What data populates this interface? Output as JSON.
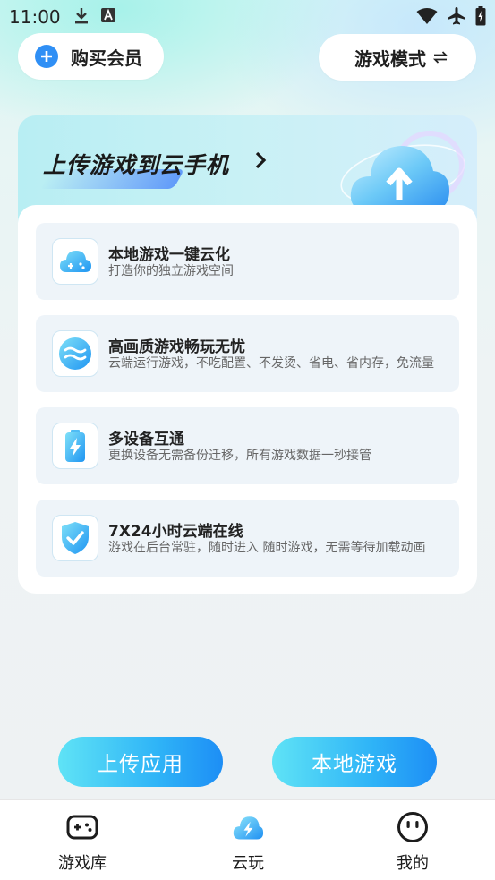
{
  "status_bar": {
    "time": "11:00",
    "icons": [
      "download-icon",
      "a-icon",
      "wifi-icon",
      "airplane-icon",
      "battery-icon"
    ]
  },
  "header": {
    "buy_vip_label": "购买会员",
    "game_mode_label": "游戏模式",
    "game_mode_icon": "⇌"
  },
  "banner": {
    "title": "上传游戏到云手机"
  },
  "features": [
    {
      "title": "本地游戏一键云化",
      "desc": "打造你的独立游戏空间",
      "icon": "cloud-gamepad-icon"
    },
    {
      "title": "高画质游戏畅玩无忧",
      "desc": "云端运行游戏，不吃配置、不发烫、省电、省内存，免流量",
      "icon": "waves-icon"
    },
    {
      "title": "多设备互通",
      "desc": "更换设备无需备份迁移，所有游戏数据一秒接管",
      "icon": "battery-bolt-icon"
    },
    {
      "title": "7X24小时云端在线",
      "desc": "游戏在后台常驻，随时进入 随时游戏，无需等待加载动画",
      "icon": "shield-check-icon"
    }
  ],
  "actions": {
    "upload_label": "上传应用",
    "local_label": "本地游戏"
  },
  "tabs": [
    {
      "label": "游戏库",
      "icon": "gamepad-icon"
    },
    {
      "label": "云玩",
      "icon": "cloud-bolt-icon"
    },
    {
      "label": "我的",
      "icon": "face-icon"
    }
  ],
  "colors": {
    "accent": "#2f8ff5",
    "button_gradient_start": "#5fe3f6",
    "button_gradient_end": "#1d8ef5"
  }
}
